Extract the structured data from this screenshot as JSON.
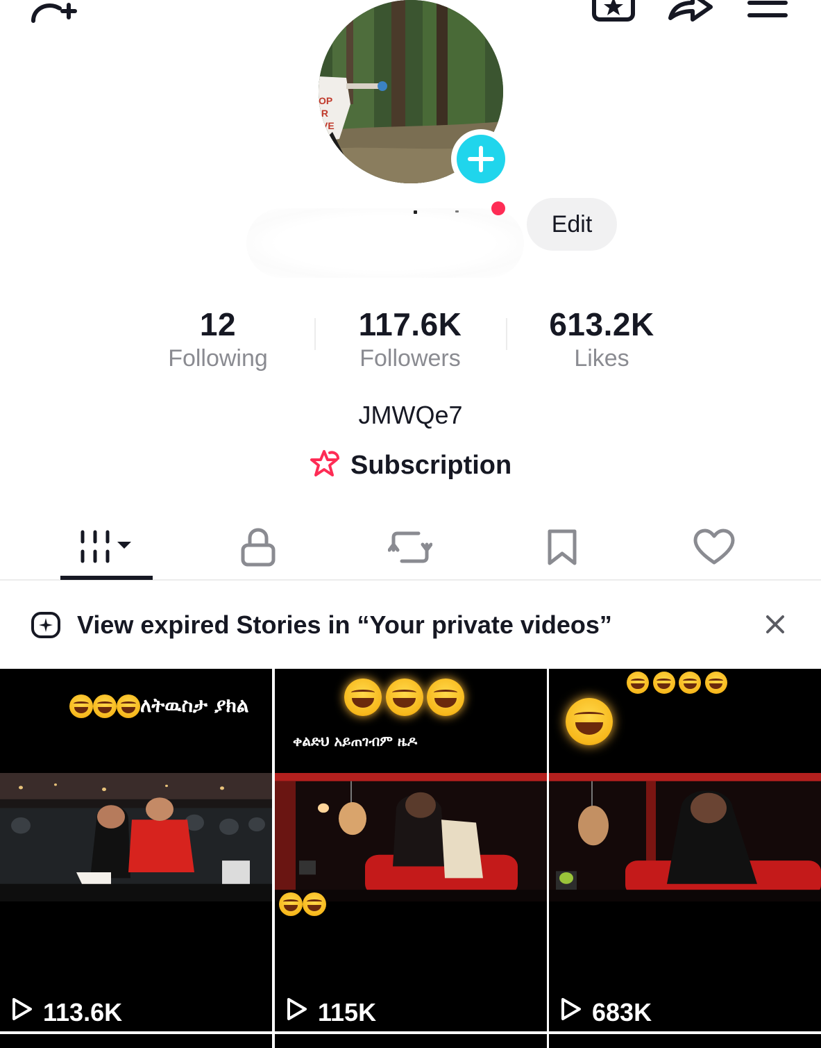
{
  "profile": {
    "edit_label": "Edit",
    "bio": "JMWQe7",
    "subscription_label": "Subscription"
  },
  "stats": {
    "following": {
      "value": "12",
      "label": "Following"
    },
    "followers": {
      "value": "117.6K",
      "label": "Followers"
    },
    "likes": {
      "value": "613.2K",
      "label": "Likes"
    }
  },
  "tabs": [
    {
      "name": "videos",
      "icon": "video-grid-icon",
      "active": true
    },
    {
      "name": "private",
      "icon": "lock-icon",
      "active": false
    },
    {
      "name": "reposts",
      "icon": "repost-icon",
      "active": false
    },
    {
      "name": "saved",
      "icon": "bookmark-icon",
      "active": false
    },
    {
      "name": "liked",
      "icon": "heart-icon",
      "active": false
    }
  ],
  "banner": {
    "text": "View expired Stories in “Your private videos”"
  },
  "videos": [
    {
      "caption": "ለትዉስታ ያክል",
      "views": "113.6K"
    },
    {
      "caption": "ቀልድህ አይጠገብም ዜዶ",
      "views": "115K"
    },
    {
      "caption": "",
      "views": "683K"
    }
  ],
  "colors": {
    "accent_pink": "#fe2c55",
    "accent_cyan": "#20d5ec",
    "text_primary": "#161823",
    "text_secondary": "#8a8b91"
  }
}
